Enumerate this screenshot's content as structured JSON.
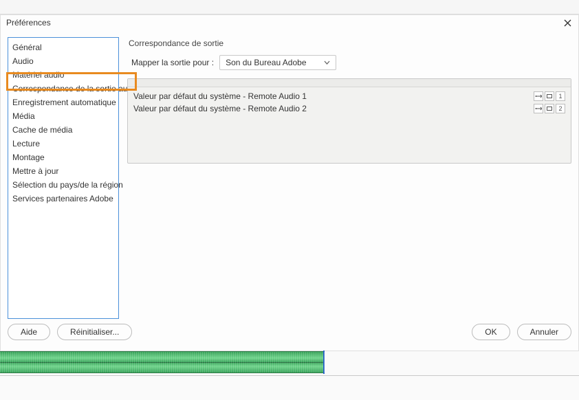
{
  "dialog": {
    "title": "Préférences",
    "section_title": "Correspondance de sortie",
    "mapper_label": "Mapper la sortie pour :",
    "mapper_value": "Son du Bureau Adobe",
    "buttons": {
      "help": "Aide",
      "reset": "Réinitialiser...",
      "ok": "OK",
      "cancel": "Annuler"
    }
  },
  "sidebar": {
    "items": [
      {
        "label": "Général"
      },
      {
        "label": "Audio"
      },
      {
        "label": "Matériel audio"
      },
      {
        "label": "Correspondance de la sortie audio"
      },
      {
        "label": "Enregistrement automatique"
      },
      {
        "label": "Média"
      },
      {
        "label": "Cache de média"
      },
      {
        "label": "Lecture"
      },
      {
        "label": "Montage"
      },
      {
        "label": "Mettre à jour"
      },
      {
        "label": "Sélection du pays/de la région"
      },
      {
        "label": "Services partenaires Adobe"
      }
    ],
    "selected_index": 3
  },
  "outputs": [
    {
      "label": "Valeur par défaut du système - Remote Audio 1",
      "channel": "1"
    },
    {
      "label": "Valeur par défaut du système - Remote Audio 2",
      "channel": "2"
    }
  ]
}
